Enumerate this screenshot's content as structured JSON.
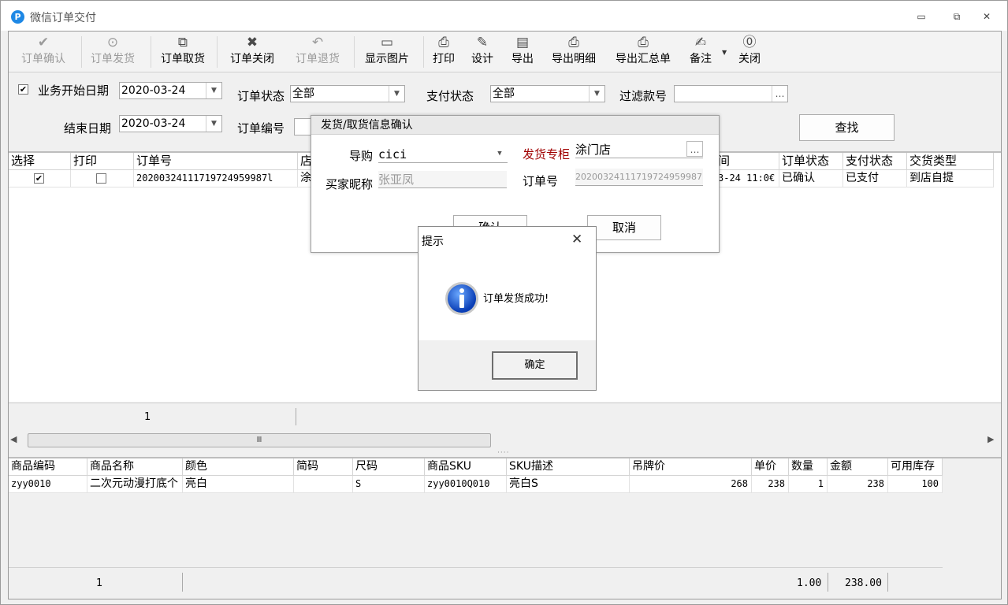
{
  "window": {
    "title": "微信订单交付",
    "app_icon": "P"
  },
  "toolbar": [
    {
      "label": "订单确认",
      "icon": "✔",
      "enabled": false
    },
    {
      "label": "订单发货",
      "icon": "⊙",
      "enabled": false
    },
    {
      "label": "订单取货",
      "icon": "⧉",
      "enabled": true
    },
    {
      "label": "订单关闭",
      "icon": "✖",
      "enabled": true
    },
    {
      "label": "订单退货",
      "icon": "↶",
      "enabled": false
    },
    {
      "label": "显示图片",
      "icon": "▭",
      "enabled": true
    },
    {
      "label": "打印",
      "icon": "⎙",
      "enabled": true
    },
    {
      "label": "设计",
      "icon": "✎",
      "enabled": true
    },
    {
      "label": "导出",
      "icon": "▤",
      "enabled": true
    },
    {
      "label": "导出明细",
      "icon": "⎙",
      "enabled": true
    },
    {
      "label": "导出汇总单",
      "icon": "⎙",
      "enabled": true
    },
    {
      "label": "备注",
      "icon": "✍",
      "enabled": true
    },
    {
      "label": "关闭",
      "icon": "⓪",
      "enabled": true
    }
  ],
  "filter": {
    "biz_start_label": "业务开始日期",
    "start_date": "2020-03-24",
    "end_label": "结束日期",
    "end_date": "2020-03-24",
    "order_status_label": "订单状态",
    "order_status_value": "全部",
    "pay_status_label": "支付状态",
    "pay_status_value": "全部",
    "filter_sku_label": "过滤款号",
    "filter_sku_value": "",
    "order_no_label": "订单编号",
    "search_button": "查找",
    "ellipsis": "…"
  },
  "grid1": {
    "headers": [
      "选择",
      "打印",
      "订单号",
      "店",
      "间",
      "订单状态",
      "支付状态",
      "交货类型"
    ],
    "rows": [
      {
        "order_no": "20200324111719724959987l",
        "store": "涂",
        "time": "3-24 11:0€",
        "order_status": "已确认",
        "pay_status": "已支付",
        "delivery": "到店自提"
      }
    ],
    "footer_count": "1",
    "scroll_grip": "Ⅲ"
  },
  "grid2": {
    "headers": [
      "商品编码",
      "商品名称",
      "颜色",
      "简码",
      "尺码",
      "商品SKU",
      "SKU描述",
      "吊牌价",
      "单价",
      "数量",
      "金额",
      "可用库存"
    ],
    "rows": [
      {
        "code": "zyy0010",
        "name": "二次元动漫打底个",
        "color": "亮白",
        "short": "",
        "size": "S",
        "sku": "zyy0010Q010",
        "sku_desc": "亮白S",
        "tag_price": "268",
        "price": "238",
        "qty": "1",
        "amount": "238",
        "stock": "100"
      }
    ],
    "footer_count": "1",
    "footer_qty": "1.00",
    "footer_amount": "238.00"
  },
  "dialog_delivery": {
    "title": "发货/取货信息确认",
    "guide_label": "导购",
    "guide_value": "cici",
    "cabinet_label": "发货专柜",
    "cabinet_value": "涂门店",
    "buyer_label": "买家昵称",
    "buyer_value": "张亚凤",
    "order_label": "订单号",
    "order_value": "202003241117197249599871",
    "confirm": "确认",
    "cancel": "取消"
  },
  "dialog_tip": {
    "title": "提示",
    "message": "订单发货成功!",
    "ok": "确定",
    "close": "✕"
  }
}
